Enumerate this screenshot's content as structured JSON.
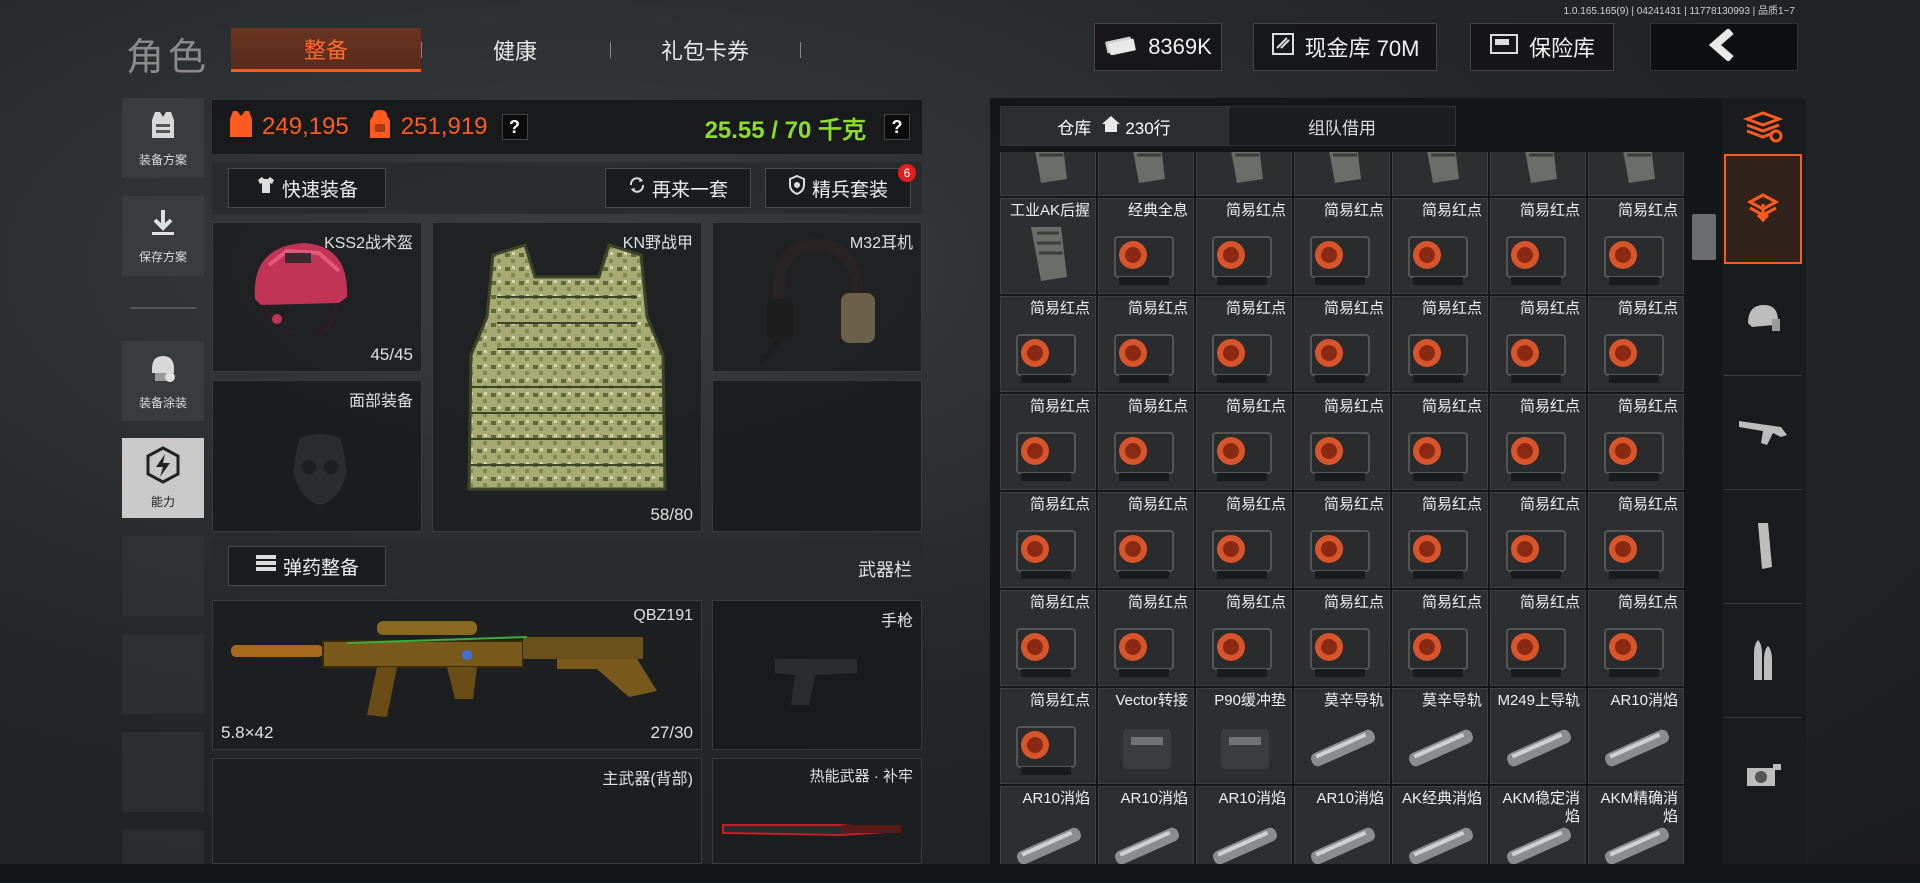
{
  "version": "1.0.165.165(9) | 04241431 | 11778130993 | 品质1~7",
  "header": {
    "title": "角色",
    "tabs": [
      {
        "label": "整备",
        "active": true
      },
      {
        "label": "健康",
        "active": false
      },
      {
        "label": "礼包卡券",
        "active": false
      }
    ],
    "money": "8369K",
    "cash_vault": "现金库 70M",
    "safe": "保险库"
  },
  "sidebar": {
    "items": [
      {
        "label": "装备方案",
        "icon": "vest-plan-icon"
      },
      {
        "label": "保存方案",
        "icon": "save-download-icon"
      },
      {
        "label": "装备涂装",
        "icon": "helmet-skin-icon"
      },
      {
        "label": "能力",
        "icon": "ability-lightning-icon"
      }
    ]
  },
  "stats": {
    "armor_value": "249,195",
    "bag_value": "251,919",
    "weight": "25.55 / 70 千克",
    "help": "?"
  },
  "actions": {
    "quick_equip": "快速装备",
    "again": "再来一套",
    "elite": "精兵套装",
    "elite_badge": "6",
    "ammo": "弹药整备",
    "weapon_bar": "武器栏"
  },
  "slots": {
    "helmet": {
      "name": "KSS2战术盔",
      "durability": "45/45"
    },
    "armor": {
      "name": "KN野战甲",
      "durability": "58/80"
    },
    "headset": {
      "name": "M32耳机"
    },
    "face": {
      "name": "面部装备"
    },
    "primary": {
      "name": "QBZ191",
      "caliber": "5.8×42",
      "ammo": "27/30"
    },
    "pistol": {
      "name": "手枪"
    },
    "back_weapon": {
      "name": "主武器(背部)"
    },
    "melee": {
      "name": "热能武器 · 补牢"
    }
  },
  "inventory": {
    "tabs": [
      {
        "label": "仓库",
        "count": "230行",
        "active": true
      },
      {
        "label": "组队借用",
        "active": false
      }
    ],
    "rows": [
      [
        "",
        "",
        "",
        "",
        "",
        "握",
        "握"
      ],
      [
        "工业AK后握",
        "经典全息",
        "简易红点",
        "简易红点",
        "简易红点",
        "简易红点",
        "简易红点"
      ],
      [
        "简易红点",
        "简易红点",
        "简易红点",
        "简易红点",
        "简易红点",
        "简易红点",
        "简易红点"
      ],
      [
        "简易红点",
        "简易红点",
        "简易红点",
        "简易红点",
        "简易红点",
        "简易红点",
        "简易红点"
      ],
      [
        "简易红点",
        "简易红点",
        "简易红点",
        "简易红点",
        "简易红点",
        "简易红点",
        "简易红点"
      ],
      [
        "简易红点",
        "简易红点",
        "简易红点",
        "简易红点",
        "简易红点",
        "简易红点",
        "简易红点"
      ],
      [
        "简易红点",
        "Vector转接",
        "P90缓冲垫",
        "莫辛导轨",
        "莫辛导轨",
        "M249上导轨",
        "AR10消焰"
      ],
      [
        "AR10消焰",
        "AR10消焰",
        "AR10消焰",
        "AR10消焰",
        "AK经典消焰",
        "AKM稳定消焰",
        "AKM精确消焰"
      ]
    ]
  },
  "right_bar_icons": [
    "sort-icon",
    "storage-in-icon",
    "helmet-icon",
    "rifle-icon",
    "magazine-icon",
    "ammo-icon",
    "sight-icon"
  ]
}
